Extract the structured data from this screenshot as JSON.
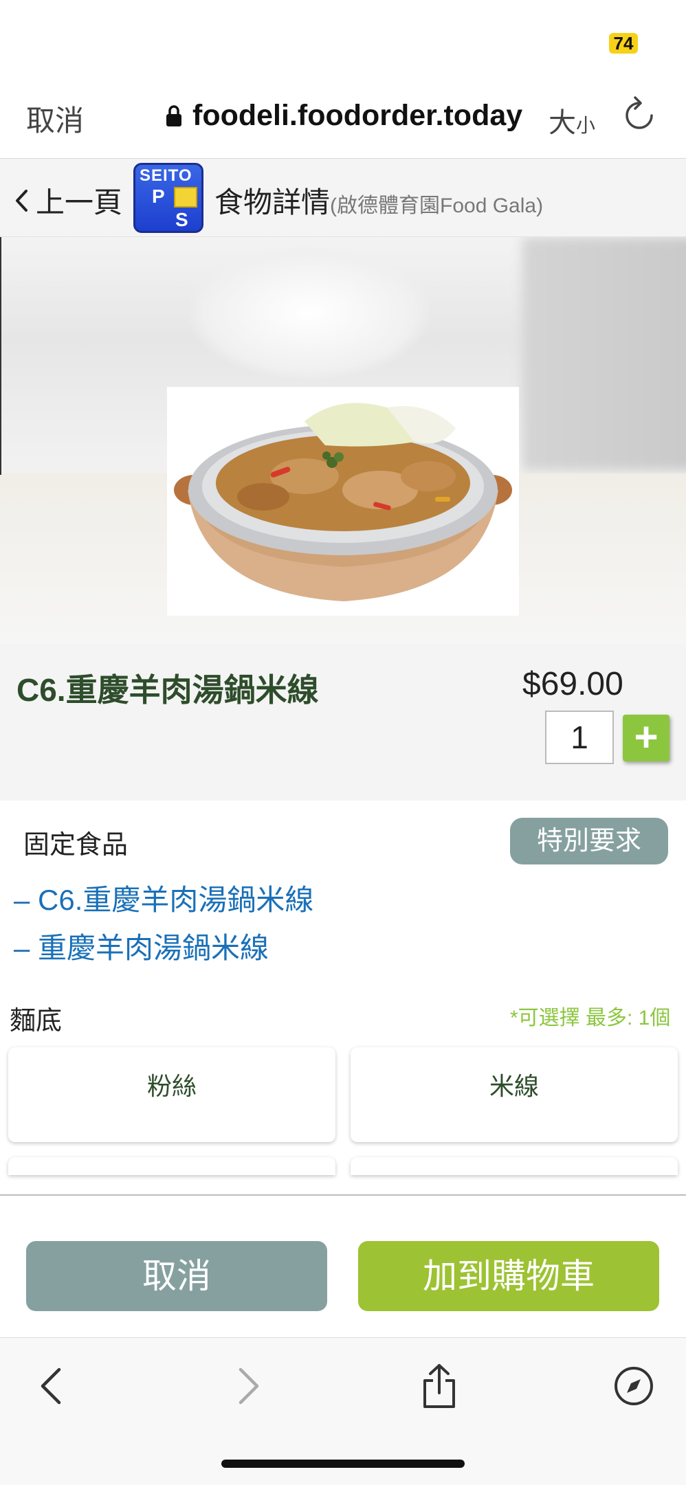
{
  "status_bar": {
    "battery": "74"
  },
  "browser": {
    "cancel_label": "取消",
    "url": "foodeli.foodorder.today",
    "text_size_big": "大",
    "text_size_small": "小"
  },
  "app_header": {
    "back_label": "上一頁",
    "logo": {
      "line1": "SEITO",
      "line2": "P",
      "line3": "S"
    },
    "title": "食物詳情",
    "subtitle": "(啟德體育園Food Gala)"
  },
  "product": {
    "name": "C6.重慶羊肉湯鍋米線",
    "price": "$69.00",
    "quantity": "1",
    "plus_symbol": "+"
  },
  "fixed_items": {
    "label": "固定食品",
    "special_request_label": "特別要求",
    "items": [
      "– C6.重慶羊肉湯鍋米線",
      "– 重慶羊肉湯鍋米線"
    ]
  },
  "option_group": {
    "label": "麵底",
    "requirement": "*可選擇 最多: 1個",
    "options": [
      "粉絲",
      "米線"
    ]
  },
  "actions": {
    "cancel_label": "取消",
    "add_to_cart_label": "加到購物車"
  },
  "colors": {
    "accent_green": "#8cc63f",
    "button_gray": "#86a0a0",
    "link_blue": "#1a70b8",
    "title_green": "#2e4d2b"
  },
  "icons": {
    "lock": "lock-icon",
    "reload": "reload-icon",
    "back": "chevron-left-icon",
    "nav_back": "nav-back-icon",
    "nav_forward": "nav-forward-icon",
    "share": "share-icon",
    "compass": "compass-icon"
  }
}
